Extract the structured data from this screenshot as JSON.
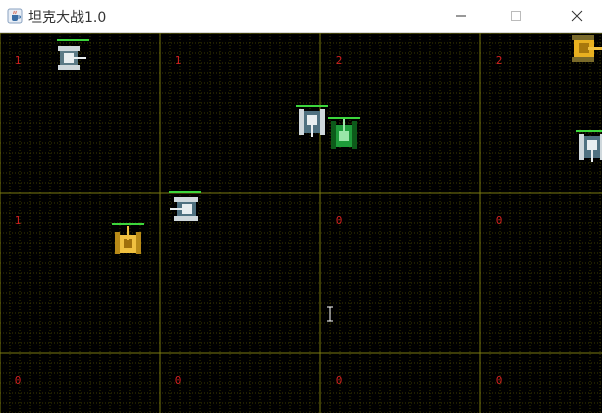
{
  "window": {
    "title": "坦克大战1.0",
    "app_icon": "java-cup-icon",
    "controls": [
      "minimize",
      "maximize",
      "close"
    ]
  },
  "board": {
    "background": "#000000",
    "grid_minor_color": "#3a3a00",
    "grid_major_color": "#7a7a10",
    "number_color": "#d02020",
    "cell_numbers": [
      [
        "1",
        "1",
        "2",
        "2"
      ],
      [
        "1",
        "",
        "0",
        "0"
      ],
      [
        "0",
        "0",
        "0",
        "0"
      ]
    ]
  },
  "tanks": [
    {
      "type": "enemy-white",
      "facing": "right",
      "hp": 1.0
    },
    {
      "type": "enemy-white",
      "facing": "down",
      "hp": 1.0
    },
    {
      "type": "ally-green",
      "facing": "up",
      "hp": 1.0
    },
    {
      "type": "enemy-white",
      "facing": "down",
      "hp": 1.0
    },
    {
      "type": "enemy-white",
      "facing": "left",
      "hp": 1.0
    },
    {
      "type": "player-gold",
      "facing": "up",
      "hp": 1.0
    },
    {
      "type": "enemy-gold",
      "facing": "right",
      "hp": 1.0
    }
  ]
}
